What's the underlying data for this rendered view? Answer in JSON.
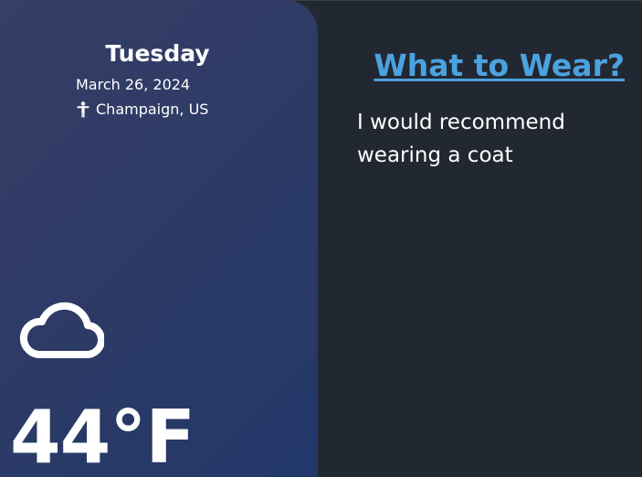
{
  "weather": {
    "day": "Tuesday",
    "date": "March 26, 2024",
    "location": "Champaign, US",
    "temperature": "44°F",
    "condition_icon": "cloud-icon",
    "location_icon": "person-pin-icon"
  },
  "wear": {
    "title": "What to Wear?",
    "recommendation": "I would recommend wearing a coat"
  },
  "colors": {
    "background": "#222831",
    "card_gradient_start": "#363f66",
    "card_gradient_end": "#22386a",
    "accent": "#4aa3e0",
    "text": "#ffffff"
  }
}
